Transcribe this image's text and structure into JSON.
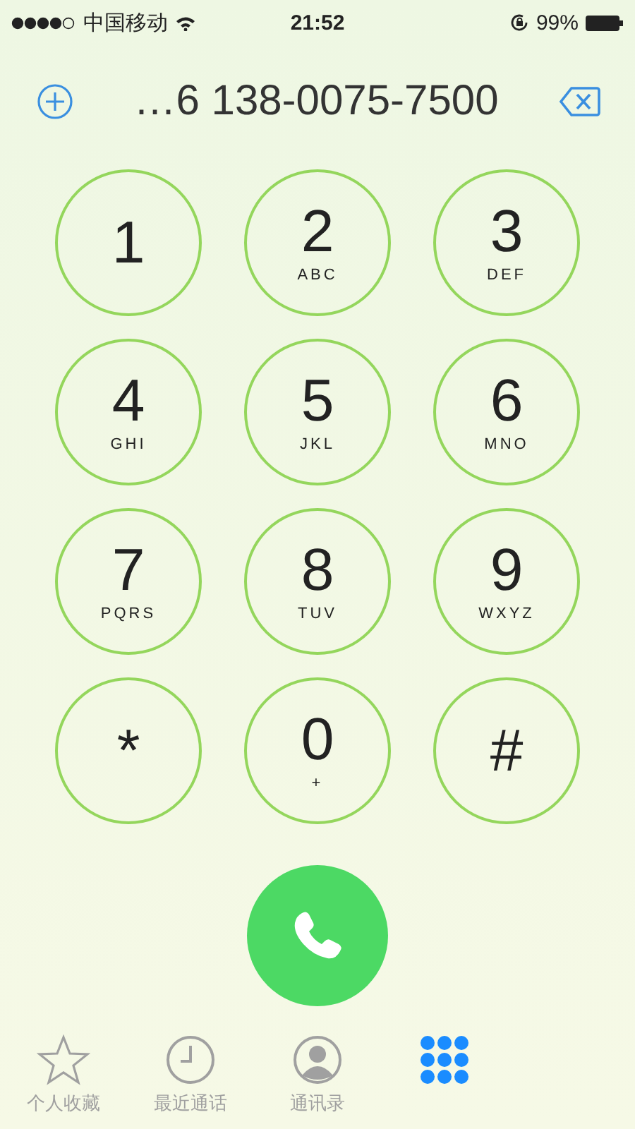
{
  "status_bar": {
    "carrier": "中国移动",
    "time": "21:52",
    "battery": "99%"
  },
  "dialer": {
    "number": "…6 138-0075-7500"
  },
  "keys": [
    {
      "digit": "1"
    },
    {
      "digit": "2",
      "letters": "ABC"
    },
    {
      "digit": "3",
      "letters": "DEF"
    },
    {
      "digit": "4",
      "letters": "GHI"
    },
    {
      "digit": "5",
      "letters": "JKL"
    },
    {
      "digit": "6",
      "letters": "MNO"
    },
    {
      "digit": "7",
      "letters": "PQRS"
    },
    {
      "digit": "8",
      "letters": "TUV"
    },
    {
      "digit": "9",
      "letters": "WXYZ"
    },
    {
      "digit": "*"
    },
    {
      "digit": "0",
      "letters": "+"
    },
    {
      "digit": "#"
    }
  ],
  "tabs": [
    {
      "kind": "star",
      "label": "个人收藏",
      "selected": false
    },
    {
      "kind": "clock",
      "label": "最近通话",
      "selected": false
    },
    {
      "kind": "person",
      "label": "通讯录",
      "selected": false
    },
    {
      "kind": "keypad",
      "selected": true
    }
  ]
}
